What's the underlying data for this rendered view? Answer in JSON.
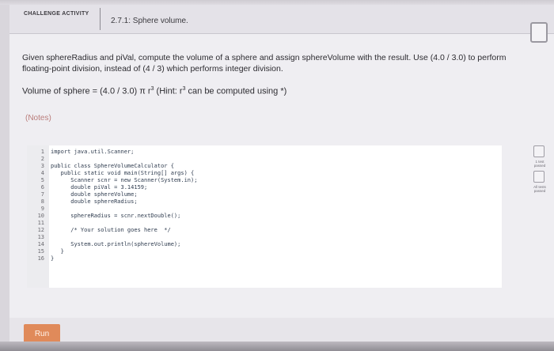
{
  "header": {
    "tag": "CHALLENGE ACTIVITY",
    "title": "2.7.1: Sphere volume."
  },
  "instructions": {
    "text": "Given sphereRadius and piVal, compute the volume of a sphere and assign sphereVolume with the result. Use (4.0 / 3.0) to perform floating-point division, instead of (4 / 3) which performs integer division.",
    "formula_prefix": "Volume of sphere = (4.0 / 3.0) π r",
    "formula_sup": "3",
    "formula_hint_prefix": " (Hint: r",
    "formula_hint_sup": "3",
    "formula_hint_suffix": " can be computed using *)",
    "notes": "(Notes)"
  },
  "editor": {
    "lines": [
      {
        "num": "1",
        "code": "import java.util.Scanner;"
      },
      {
        "num": "2",
        "code": ""
      },
      {
        "num": "3",
        "code": "public class SphereVolumeCalculator {"
      },
      {
        "num": "4",
        "code": "   public static void main(String[] args) {"
      },
      {
        "num": "5",
        "code": "      Scanner scnr = new Scanner(System.in);"
      },
      {
        "num": "6",
        "code": "      double piVal = 3.14159;"
      },
      {
        "num": "7",
        "code": "      double sphereVolume;"
      },
      {
        "num": "8",
        "code": "      double sphereRadius;"
      },
      {
        "num": "9",
        "code": ""
      },
      {
        "num": "10",
        "code": "      sphereRadius = scnr.nextDouble();"
      },
      {
        "num": "11",
        "code": ""
      },
      {
        "num": "12",
        "code": "      /* Your solution goes here  */"
      },
      {
        "num": "13",
        "code": ""
      },
      {
        "num": "14",
        "code": "      System.out.println(sphereVolume);"
      },
      {
        "num": "15",
        "code": "   }"
      },
      {
        "num": "16",
        "code": "}"
      }
    ]
  },
  "side_status": {
    "test1_line1": "1 test",
    "test1_line2": "passed",
    "test2_line1": "All tests",
    "test2_line2": "passed"
  },
  "run_label": "Run"
}
